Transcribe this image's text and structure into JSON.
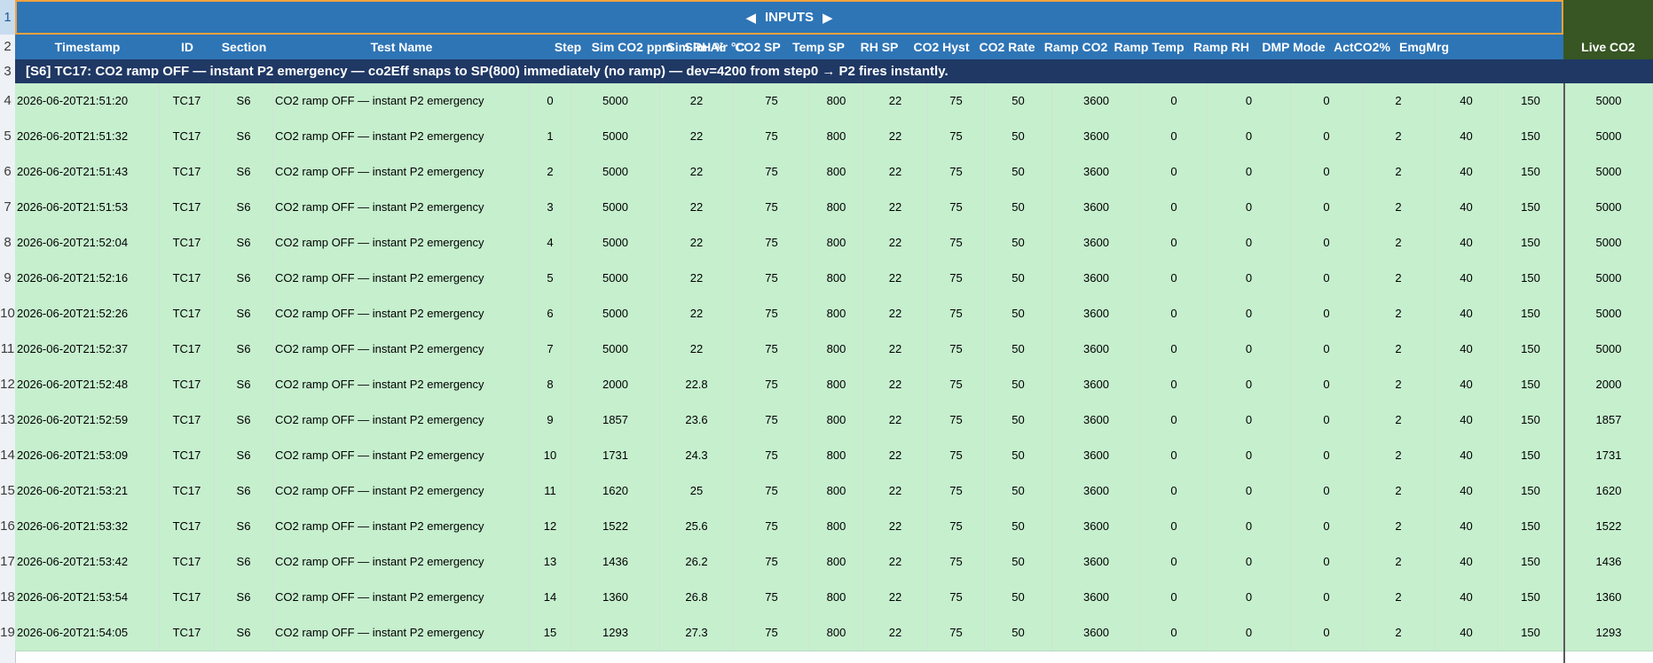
{
  "sheet": {
    "row_numbers": [
      "1",
      "2",
      "3",
      "4",
      "5",
      "6",
      "7",
      "8",
      "9",
      "10",
      "11",
      "12",
      "13",
      "14",
      "15",
      "16",
      "17",
      "18",
      "19"
    ],
    "banner": {
      "label": "INPUTS",
      "left_arrow": "◀",
      "right_arrow": "▶"
    },
    "columns": [
      "Timestamp",
      "ID",
      "Section",
      "Test Name",
      "Step",
      "Sim CO2 ppm",
      "Sim Air °C",
      "Sim RH %",
      "CO2 SP",
      "Temp SP",
      "RH SP",
      "CO2 Hyst",
      "CO2 Rate",
      "Ramp CO2",
      "Ramp Temp",
      "Ramp RH",
      "DMP Mode",
      "ActCO2%",
      "EmgMrg",
      "Live CO2"
    ],
    "section_note": "[S6]  TC17: CO2 ramp OFF — instant P2 emergency  —  co2Eff snaps to SP(800) immediately (no ramp) — dev=4200 from step0 → P2 fires instantly.",
    "rows": [
      [
        "2026-06-20T21:51:20",
        "TC17",
        "S6",
        "CO2 ramp OFF — instant P2 emergency",
        "0",
        "5000",
        "22",
        "75",
        "800",
        "22",
        "75",
        "50",
        "3600",
        "0",
        "0",
        "0",
        "2",
        "40",
        "150",
        "5000"
      ],
      [
        "2026-06-20T21:51:32",
        "TC17",
        "S6",
        "CO2 ramp OFF — instant P2 emergency",
        "1",
        "5000",
        "22",
        "75",
        "800",
        "22",
        "75",
        "50",
        "3600",
        "0",
        "0",
        "0",
        "2",
        "40",
        "150",
        "5000"
      ],
      [
        "2026-06-20T21:51:43",
        "TC17",
        "S6",
        "CO2 ramp OFF — instant P2 emergency",
        "2",
        "5000",
        "22",
        "75",
        "800",
        "22",
        "75",
        "50",
        "3600",
        "0",
        "0",
        "0",
        "2",
        "40",
        "150",
        "5000"
      ],
      [
        "2026-06-20T21:51:53",
        "TC17",
        "S6",
        "CO2 ramp OFF — instant P2 emergency",
        "3",
        "5000",
        "22",
        "75",
        "800",
        "22",
        "75",
        "50",
        "3600",
        "0",
        "0",
        "0",
        "2",
        "40",
        "150",
        "5000"
      ],
      [
        "2026-06-20T21:52:04",
        "TC17",
        "S6",
        "CO2 ramp OFF — instant P2 emergency",
        "4",
        "5000",
        "22",
        "75",
        "800",
        "22",
        "75",
        "50",
        "3600",
        "0",
        "0",
        "0",
        "2",
        "40",
        "150",
        "5000"
      ],
      [
        "2026-06-20T21:52:16",
        "TC17",
        "S6",
        "CO2 ramp OFF — instant P2 emergency",
        "5",
        "5000",
        "22",
        "75",
        "800",
        "22",
        "75",
        "50",
        "3600",
        "0",
        "0",
        "0",
        "2",
        "40",
        "150",
        "5000"
      ],
      [
        "2026-06-20T21:52:26",
        "TC17",
        "S6",
        "CO2 ramp OFF — instant P2 emergency",
        "6",
        "5000",
        "22",
        "75",
        "800",
        "22",
        "75",
        "50",
        "3600",
        "0",
        "0",
        "0",
        "2",
        "40",
        "150",
        "5000"
      ],
      [
        "2026-06-20T21:52:37",
        "TC17",
        "S6",
        "CO2 ramp OFF — instant P2 emergency",
        "7",
        "5000",
        "22",
        "75",
        "800",
        "22",
        "75",
        "50",
        "3600",
        "0",
        "0",
        "0",
        "2",
        "40",
        "150",
        "5000"
      ],
      [
        "2026-06-20T21:52:48",
        "TC17",
        "S6",
        "CO2 ramp OFF — instant P2 emergency",
        "8",
        "2000",
        "22.8",
        "75",
        "800",
        "22",
        "75",
        "50",
        "3600",
        "0",
        "0",
        "0",
        "2",
        "40",
        "150",
        "2000"
      ],
      [
        "2026-06-20T21:52:59",
        "TC17",
        "S6",
        "CO2 ramp OFF — instant P2 emergency",
        "9",
        "1857",
        "23.6",
        "75",
        "800",
        "22",
        "75",
        "50",
        "3600",
        "0",
        "0",
        "0",
        "2",
        "40",
        "150",
        "1857"
      ],
      [
        "2026-06-20T21:53:09",
        "TC17",
        "S6",
        "CO2 ramp OFF — instant P2 emergency",
        "10",
        "1731",
        "24.3",
        "75",
        "800",
        "22",
        "75",
        "50",
        "3600",
        "0",
        "0",
        "0",
        "2",
        "40",
        "150",
        "1731"
      ],
      [
        "2026-06-20T21:53:21",
        "TC17",
        "S6",
        "CO2 ramp OFF — instant P2 emergency",
        "11",
        "1620",
        "25",
        "75",
        "800",
        "22",
        "75",
        "50",
        "3600",
        "0",
        "0",
        "0",
        "2",
        "40",
        "150",
        "1620"
      ],
      [
        "2026-06-20T21:53:32",
        "TC17",
        "S6",
        "CO2 ramp OFF — instant P2 emergency",
        "12",
        "1522",
        "25.6",
        "75",
        "800",
        "22",
        "75",
        "50",
        "3600",
        "0",
        "0",
        "0",
        "2",
        "40",
        "150",
        "1522"
      ],
      [
        "2026-06-20T21:53:42",
        "TC17",
        "S6",
        "CO2 ramp OFF — instant P2 emergency",
        "13",
        "1436",
        "26.2",
        "75",
        "800",
        "22",
        "75",
        "50",
        "3600",
        "0",
        "0",
        "0",
        "2",
        "40",
        "150",
        "1436"
      ],
      [
        "2026-06-20T21:53:54",
        "TC17",
        "S6",
        "CO2 ramp OFF — instant P2 emergency",
        "14",
        "1360",
        "26.8",
        "75",
        "800",
        "22",
        "75",
        "50",
        "3600",
        "0",
        "0",
        "0",
        "2",
        "40",
        "150",
        "1360"
      ],
      [
        "2026-06-20T21:54:05",
        "TC17",
        "S6",
        "CO2 ramp OFF — instant P2 emergency",
        "15",
        "1293",
        "27.3",
        "75",
        "800",
        "22",
        "75",
        "50",
        "3600",
        "0",
        "0",
        "0",
        "2",
        "40",
        "150",
        "1293"
      ]
    ]
  },
  "colors": {
    "header_blue": "#2e75b6",
    "section_navy": "#1f3864",
    "row_green": "#c6efce",
    "live_green": "#375623",
    "banner_border": "#f2a23d"
  }
}
